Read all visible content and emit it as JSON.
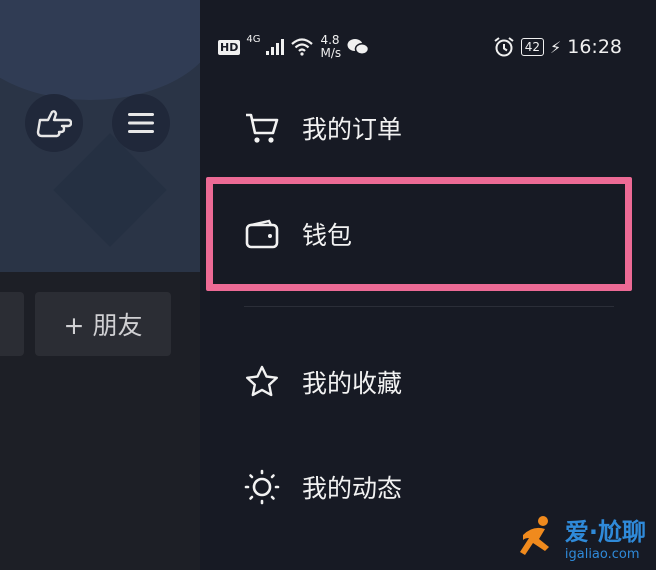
{
  "left_panel": {
    "add_friend_label": "+ 朋友"
  },
  "status_bar": {
    "hd_badge": "HD",
    "network": "4G",
    "speed_value": "4.8",
    "speed_unit": "M/s",
    "battery": "42",
    "time": "16:28"
  },
  "menu": {
    "items": [
      {
        "label": "我的订单",
        "icon": "cart-icon"
      },
      {
        "label": "钱包",
        "icon": "wallet-icon"
      },
      {
        "label": "我的收藏",
        "icon": "star-icon"
      },
      {
        "label": "我的动态",
        "icon": "sun-icon"
      }
    ]
  },
  "watermark": {
    "text": "爱·尬聊",
    "url": "igaliao.com"
  },
  "colors": {
    "highlight": "#ec6a95",
    "drawer_bg": "#171a24",
    "accent_watermark": "#2f8ad9"
  }
}
